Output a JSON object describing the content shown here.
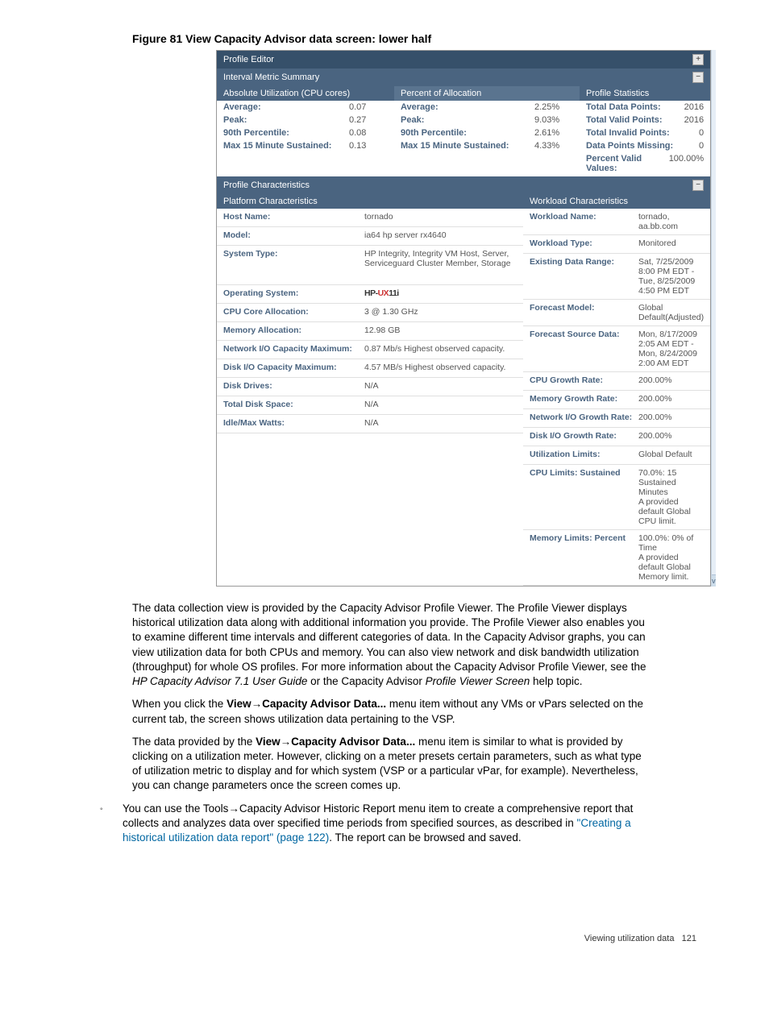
{
  "figure_caption": "Figure 81 View Capacity Advisor data screen: lower half",
  "panels": {
    "profile_editor": "Profile Editor",
    "interval_metric": "Interval Metric Summary",
    "profile_characteristics": "Profile Characteristics"
  },
  "subheaders": {
    "absolute": "Absolute Utilization (CPU cores)",
    "percent": "Percent of Allocation",
    "stats": "Profile Statistics",
    "platform": "Platform Characteristics",
    "workload": "Workload Characteristics"
  },
  "absolute": [
    {
      "k": "Average:",
      "v": "0.07"
    },
    {
      "k": "Peak:",
      "v": "0.27"
    },
    {
      "k": "90th Percentile:",
      "v": "0.08"
    },
    {
      "k": "Max 15 Minute Sustained:",
      "v": "0.13"
    }
  ],
  "percent": [
    {
      "k": "Average:",
      "v": "2.25%"
    },
    {
      "k": "Peak:",
      "v": "9.03%"
    },
    {
      "k": "90th Percentile:",
      "v": "2.61%"
    },
    {
      "k": "Max 15 Minute Sustained:",
      "v": "4.33%"
    }
  ],
  "stats": [
    {
      "k": "Total Data Points:",
      "v": "2016"
    },
    {
      "k": "Total Valid Points:",
      "v": "2016"
    },
    {
      "k": "Total Invalid Points:",
      "v": "0"
    },
    {
      "k": "Data Points Missing:",
      "v": "0"
    },
    {
      "k": "Percent Valid Values:",
      "v": "100.00%"
    }
  ],
  "platform": [
    {
      "k": "Host Name:",
      "v": "tornado"
    },
    {
      "k": "Model:",
      "v": "ia64 hp server rx4640"
    },
    {
      "k": "System Type:",
      "v": "HP Integrity, Integrity VM Host, Server, Serviceguard Cluster Member, Storage"
    },
    {
      "k": "Operating System:",
      "v": "HP-UX 11i"
    },
    {
      "k": "CPU Core Allocation:",
      "v": "3 @ 1.30 GHz"
    },
    {
      "k": "Memory Allocation:",
      "v": "12.98 GB"
    },
    {
      "k": "Network I/O Capacity Maximum:",
      "v": "0.87 Mb/s Highest observed capacity."
    },
    {
      "k": "Disk I/O Capacity Maximum:",
      "v": "4.57 MB/s Highest observed capacity."
    },
    {
      "k": "Disk Drives:",
      "v": "N/A"
    },
    {
      "k": "Total Disk Space:",
      "v": "N/A"
    },
    {
      "k": "Idle/Max Watts:",
      "v": "N/A"
    }
  ],
  "workload": [
    {
      "k": "Workload Name:",
      "v": "tornado, aa.bb.com"
    },
    {
      "k": "Workload Type:",
      "v": "Monitored"
    },
    {
      "k": "Existing Data Range:",
      "v": "Sat, 7/25/2009 8:00 PM EDT - Tue, 8/25/2009 4:50 PM EDT"
    },
    {
      "k": "Forecast Model:",
      "v": "Global Default(Adjusted)"
    },
    {
      "k": "Forecast Source Data:",
      "v": "Mon, 8/17/2009 2:05 AM EDT - Mon, 8/24/2009 2:00 AM EDT"
    },
    {
      "k": "CPU Growth Rate:",
      "v": "200.00%"
    },
    {
      "k": "Memory Growth Rate:",
      "v": "200.00%"
    },
    {
      "k": "Network I/O Growth Rate:",
      "v": "200.00%"
    },
    {
      "k": "Disk I/O Growth Rate:",
      "v": "200.00%"
    },
    {
      "k": "Utilization Limits:",
      "v": "Global Default"
    },
    {
      "k": "CPU Limits:   Sustained",
      "v": "70.0%:   15 Sustained Minutes\nA provided default Global CPU limit."
    },
    {
      "k": "Memory Limits:   Percent",
      "v": "100.0%:   0% of Time\nA provided default Global Memory limit."
    }
  ],
  "body": {
    "p1a": "The data collection view is provided by the Capacity Advisor Profile Viewer. The Profile Viewer displays historical utilization data along with additional information you provide. The Profile Viewer also enables you to examine different time intervals and different categories of data. In the Capacity Advisor graphs, you can view utilization data for both CPUs and memory. You can also view network and disk bandwidth utilization (throughput) for whole OS profiles. For more information about the Capacity Advisor Profile Viewer, see the ",
    "p1_i1": "HP Capacity Advisor 7.1 User Guide",
    "p1b": " or the Capacity Advisor ",
    "p1_i2": "Profile Viewer Screen",
    "p1c": " help topic.",
    "p2a": "When you click the ",
    "p2_b1": "View",
    "p2_arrow": "→",
    "p2_b2": "Capacity Advisor Data...",
    "p2b": " menu item without any VMs or vPars selected on the current tab, the screen shows utilization data pertaining to the VSP.",
    "p3a": "The data provided by the ",
    "p3_b1": "View",
    "p3_arrow": "→",
    "p3_b2": "Capacity Advisor Data...",
    "p3b": " menu item is similar to what is provided by clicking on a utilization meter. However, clicking on a meter presets certain parameters, such as what type of utilization metric to display and for which system (VSP or a particular vPar, for example). Nevertheless, you can change parameters once the screen comes up.",
    "bullet_a": "You can use the ",
    "bullet_b1": "Tools",
    "bullet_arrow": "→",
    "bullet_b2": "Capacity Advisor Historic Report",
    "bullet_b": " menu item to create a comprehensive report that collects and analyzes data over specified time periods from specified sources, as described in ",
    "bullet_link": "\"Creating a historical utilization data report\" (page 122)",
    "bullet_c": ". The report can be browsed and saved."
  },
  "icons": {
    "plus": "+",
    "minus": "−",
    "down_arrow": "v"
  },
  "footer": {
    "section": "Viewing utilization data",
    "page": "121"
  }
}
